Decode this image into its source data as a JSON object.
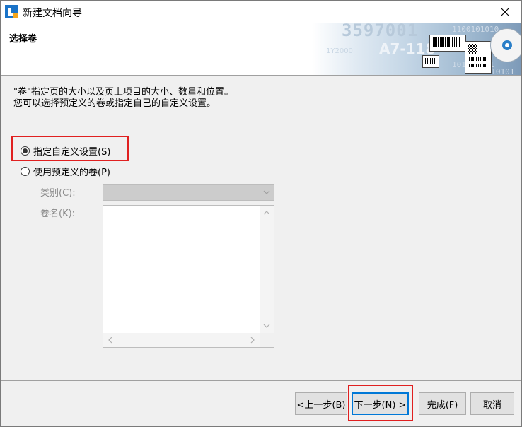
{
  "window": {
    "title": "新建文档向导"
  },
  "header": {
    "title": "选择卷",
    "banner_text_1": "3597001",
    "banner_text_2": "A7-118",
    "banner_text_3": "1Y2000",
    "banner_binary": [
      "1100101010",
      "1010 0101",
      "1010101"
    ]
  },
  "description": {
    "line1": "\"卷\"指定页的大小以及页上项目的大小、数量和位置。",
    "line2": "您可以选择预定义的卷或指定自己的自定义设置。"
  },
  "options": {
    "custom": {
      "label": "指定自定义设置(S)",
      "checked": true
    },
    "predefined": {
      "label": "使用预定义的卷(P)",
      "checked": false
    }
  },
  "fields": {
    "category_label": "类别(C):",
    "category_value": "",
    "volume_name_label": "卷名(K):"
  },
  "buttons": {
    "back": "<上一步(B)",
    "next": "下一步(N) >",
    "finish": "完成(F)",
    "cancel": "取消"
  },
  "colors": {
    "highlight": "#e02020",
    "focus": "#0078d7",
    "icon_blue": "#1a73c8",
    "icon_orange": "#f4a51c"
  }
}
